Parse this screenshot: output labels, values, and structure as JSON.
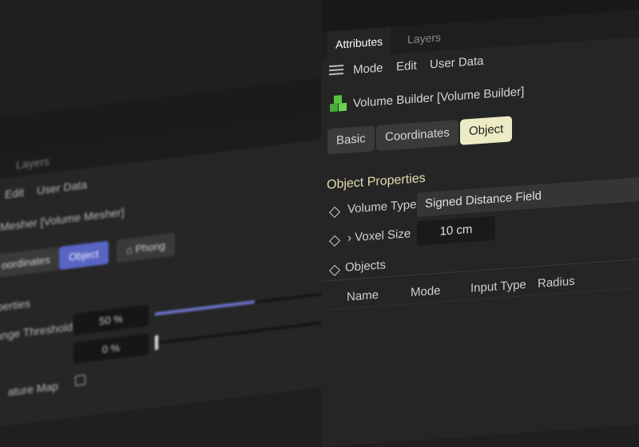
{
  "back_panel": {
    "tabs": [
      "Layers"
    ],
    "menu": [
      "Edit",
      "User Data"
    ],
    "object_title": "Mesher [Volume Mesher]",
    "buttons": [
      {
        "label": "oordinates",
        "active": false
      },
      {
        "label": "Object",
        "active": true
      },
      {
        "label": "Phong",
        "active": false
      }
    ],
    "section": "perties",
    "rows": [
      {
        "label": "ange Threshold",
        "value": "50 %",
        "fill": 0.5
      },
      {
        "label": "",
        "value": "0 %",
        "fill": 0.0
      }
    ],
    "last_row_label": "ature Map"
  },
  "front_panel": {
    "tabs": {
      "active": "Attributes",
      "inactive": "Layers"
    },
    "menu": {
      "mode": "Mode",
      "edit": "Edit",
      "user_data": "User Data"
    },
    "object_title": "Volume Builder [Volume Builder]",
    "object_buttons": {
      "basic": "Basic",
      "coordinates": "Coordinates",
      "object": "Object"
    },
    "section_title": "Object Properties",
    "volume_type": {
      "label": "Volume Type",
      "value": "Signed Distance Field"
    },
    "voxel_size": {
      "label": "Voxel Size",
      "value": "10 cm"
    },
    "objects": {
      "label": "Objects"
    },
    "columns": {
      "name": "Name",
      "mode": "Mode",
      "input_type": "Input Type",
      "radius": "Radius"
    }
  },
  "colors": {
    "accent_blue": "#5865c4",
    "active_object_button": "#ecebc4",
    "section_title": "#e4deb0",
    "cube_icon": "#58c440"
  },
  "icons": [
    "hamburger-menu-icon",
    "volume-builder-cube-icon",
    "diamond-keyframe-icon",
    "chevron-right-icon",
    "phong-tag-icon",
    "checkbox-icon"
  ]
}
